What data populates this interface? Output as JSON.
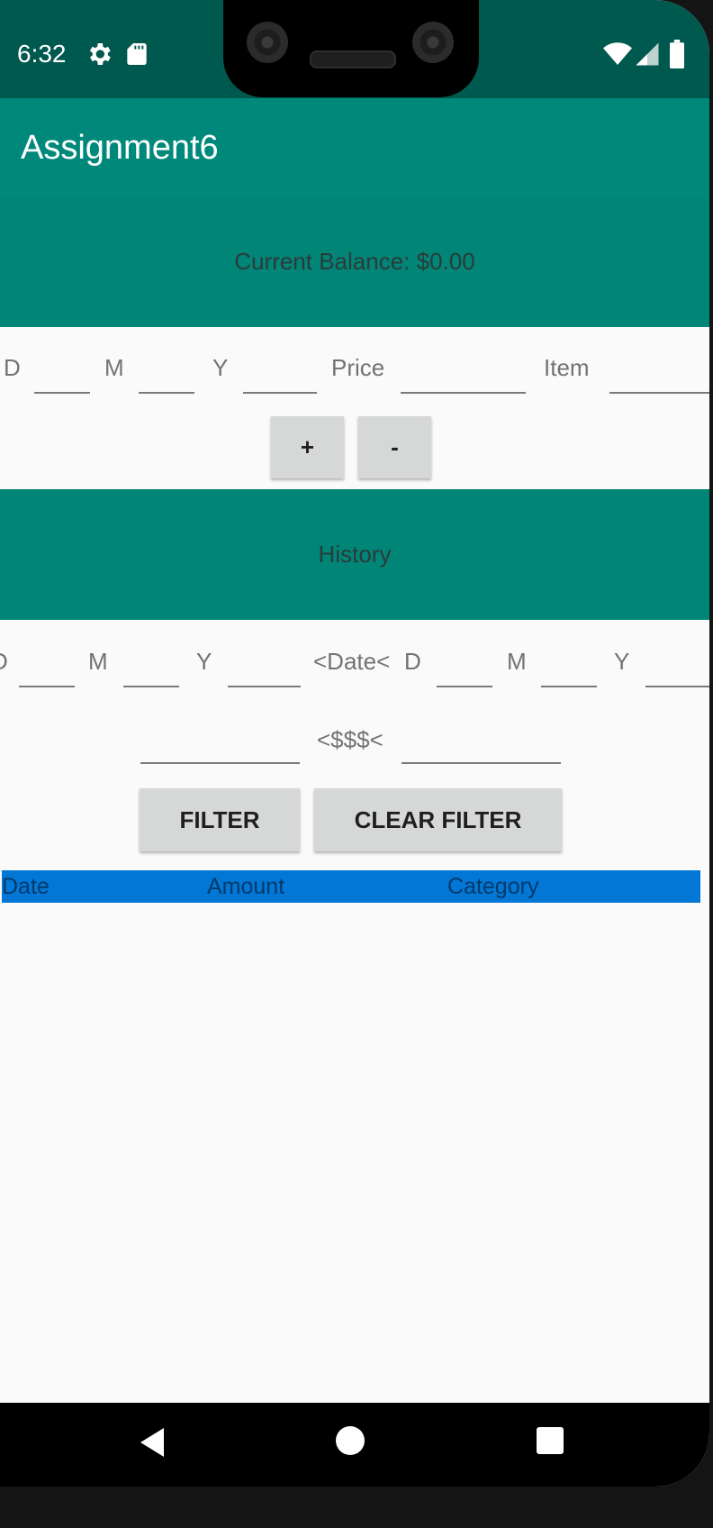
{
  "status_bar": {
    "time": "6:32",
    "icons": [
      "gear-icon",
      "sd-card-icon",
      "wifi-icon",
      "cell-signal-icon",
      "battery-icon"
    ]
  },
  "app_bar": {
    "title": "Assignment6"
  },
  "balance": {
    "text": "Current Balance: $0.00"
  },
  "entry": {
    "labels": {
      "day": "D",
      "month": "M",
      "year": "Y",
      "price": "Price",
      "item": "Item"
    },
    "fields": {
      "day": "",
      "month": "",
      "year": "",
      "price": "",
      "item": ""
    },
    "add_label": "+",
    "subtract_label": "-"
  },
  "history": {
    "title": "History",
    "date_range": {
      "from_day_label": "D",
      "from_month_label": "M",
      "from_year_label": "Y",
      "separator": "<Date<",
      "to_day_label": "D",
      "to_month_label": "M",
      "to_year_label": "Y"
    },
    "amount_range": {
      "separator": "<$$$<",
      "min_value": "",
      "max_value": ""
    },
    "filter_label": "FILTER",
    "clear_filter_label": "CLEAR FILTER",
    "columns": [
      "Date",
      "Amount",
      "Category"
    ],
    "rows": []
  },
  "nav": {
    "icons": [
      "back-icon",
      "home-icon",
      "recents-icon"
    ]
  },
  "colors": {
    "status_bar": "#00594e",
    "app_bar": "#00897b",
    "band": "#008577",
    "table_header": "#0277d5"
  }
}
